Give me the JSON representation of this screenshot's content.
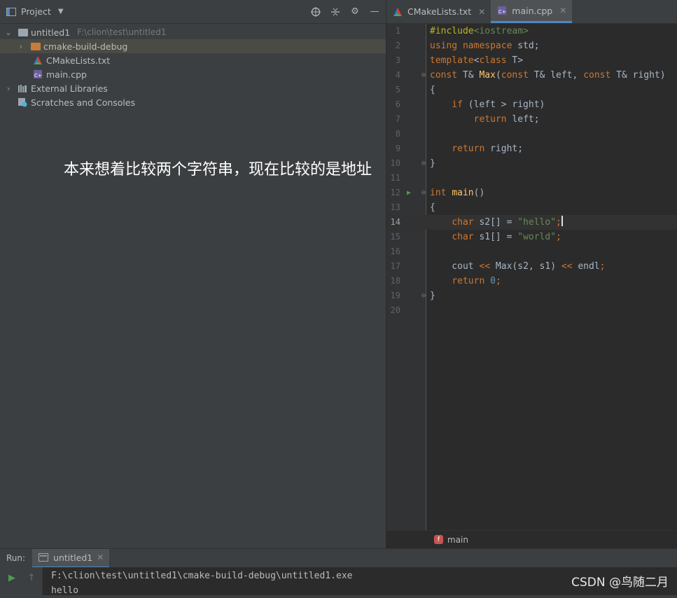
{
  "project": {
    "header_title": "Project",
    "tree": [
      {
        "label": "untitled1",
        "path": "F:\\clion\\test\\untitled1"
      },
      {
        "label": "cmake-build-debug"
      },
      {
        "label": "CMakeLists.txt"
      },
      {
        "label": "main.cpp"
      },
      {
        "label": "External Libraries"
      },
      {
        "label": "Scratches and Consoles"
      }
    ]
  },
  "overlay_caption": "本来想着比较两个字符串，现在比较的是地址",
  "editor": {
    "tabs": [
      {
        "label": "CMakeLists.txt"
      },
      {
        "label": "main.cpp"
      }
    ],
    "line_numbers": [
      "1",
      "2",
      "3",
      "4",
      "5",
      "6",
      "7",
      "8",
      "9",
      "10",
      "11",
      "12",
      "13",
      "14",
      "15",
      "16",
      "17",
      "18",
      "19",
      "20"
    ],
    "breadcrumb": "main"
  },
  "run": {
    "label": "Run:",
    "tab": "untitled1",
    "output": [
      "F:\\clion\\test\\untitled1\\cmake-build-debug\\untitled1.exe",
      "hello"
    ]
  },
  "watermark": "CSDN @鸟随二月",
  "colors": {
    "accent": "#4a88c7",
    "background": "#3c3f41",
    "editor_bg": "#2b2b2b"
  }
}
